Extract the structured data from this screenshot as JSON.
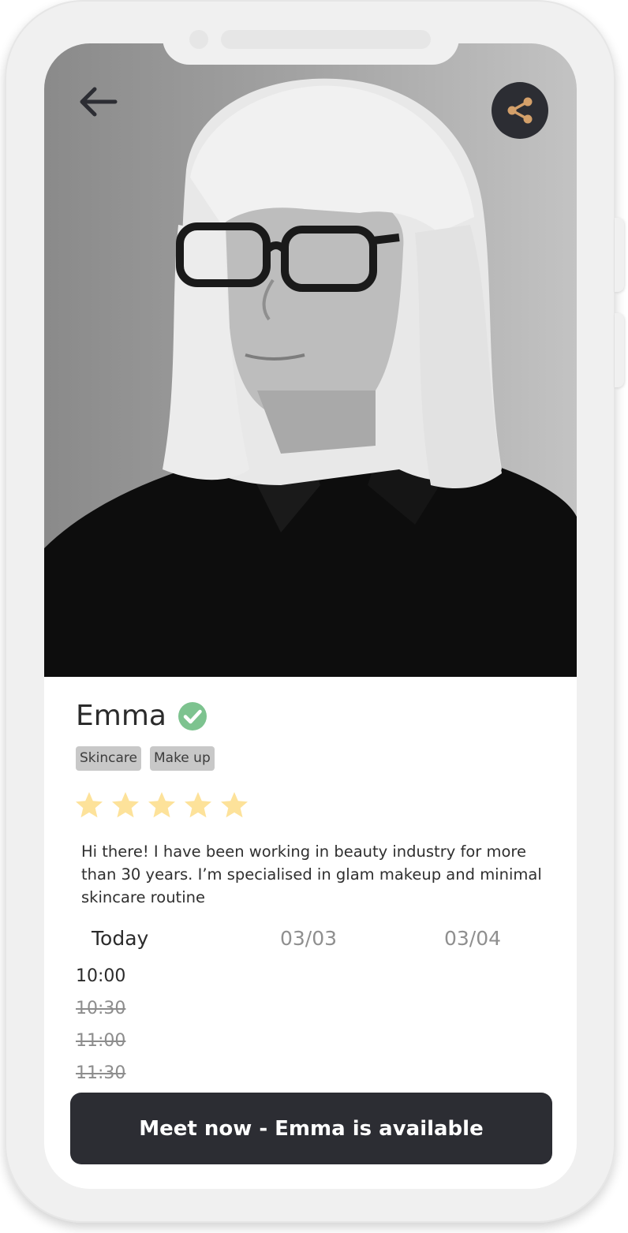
{
  "profile": {
    "name": "Emma",
    "verified": true,
    "tags": [
      "Skincare",
      "Make up"
    ],
    "rating": {
      "value": 5,
      "max": 5
    },
    "bio": "Hi there! I have been working in beauty industry for more than 30 years. I’m specialised in glam makeup and minimal skincare routine"
  },
  "schedule": {
    "days": [
      "Today",
      "03/03",
      "03/04"
    ],
    "selected_day": "Today",
    "slots": [
      {
        "time": "10:00",
        "available": true
      },
      {
        "time": "10:30",
        "available": false
      },
      {
        "time": "11:00",
        "available": false
      },
      {
        "time": "11:30",
        "available": false
      }
    ]
  },
  "cta": {
    "label": "Meet now - Emma is available"
  },
  "icons": {
    "back": "arrow-left-icon",
    "share": "share-icon",
    "verified": "check-circle-icon",
    "star": "star-icon"
  },
  "colors": {
    "dark": "#2c2d33",
    "share_accent": "#d4a06a",
    "verified_green": "#7dc38f",
    "star_yellow": "#fde29a",
    "tag_bg": "#c8c8c8",
    "muted_text": "#8f8f8f"
  }
}
